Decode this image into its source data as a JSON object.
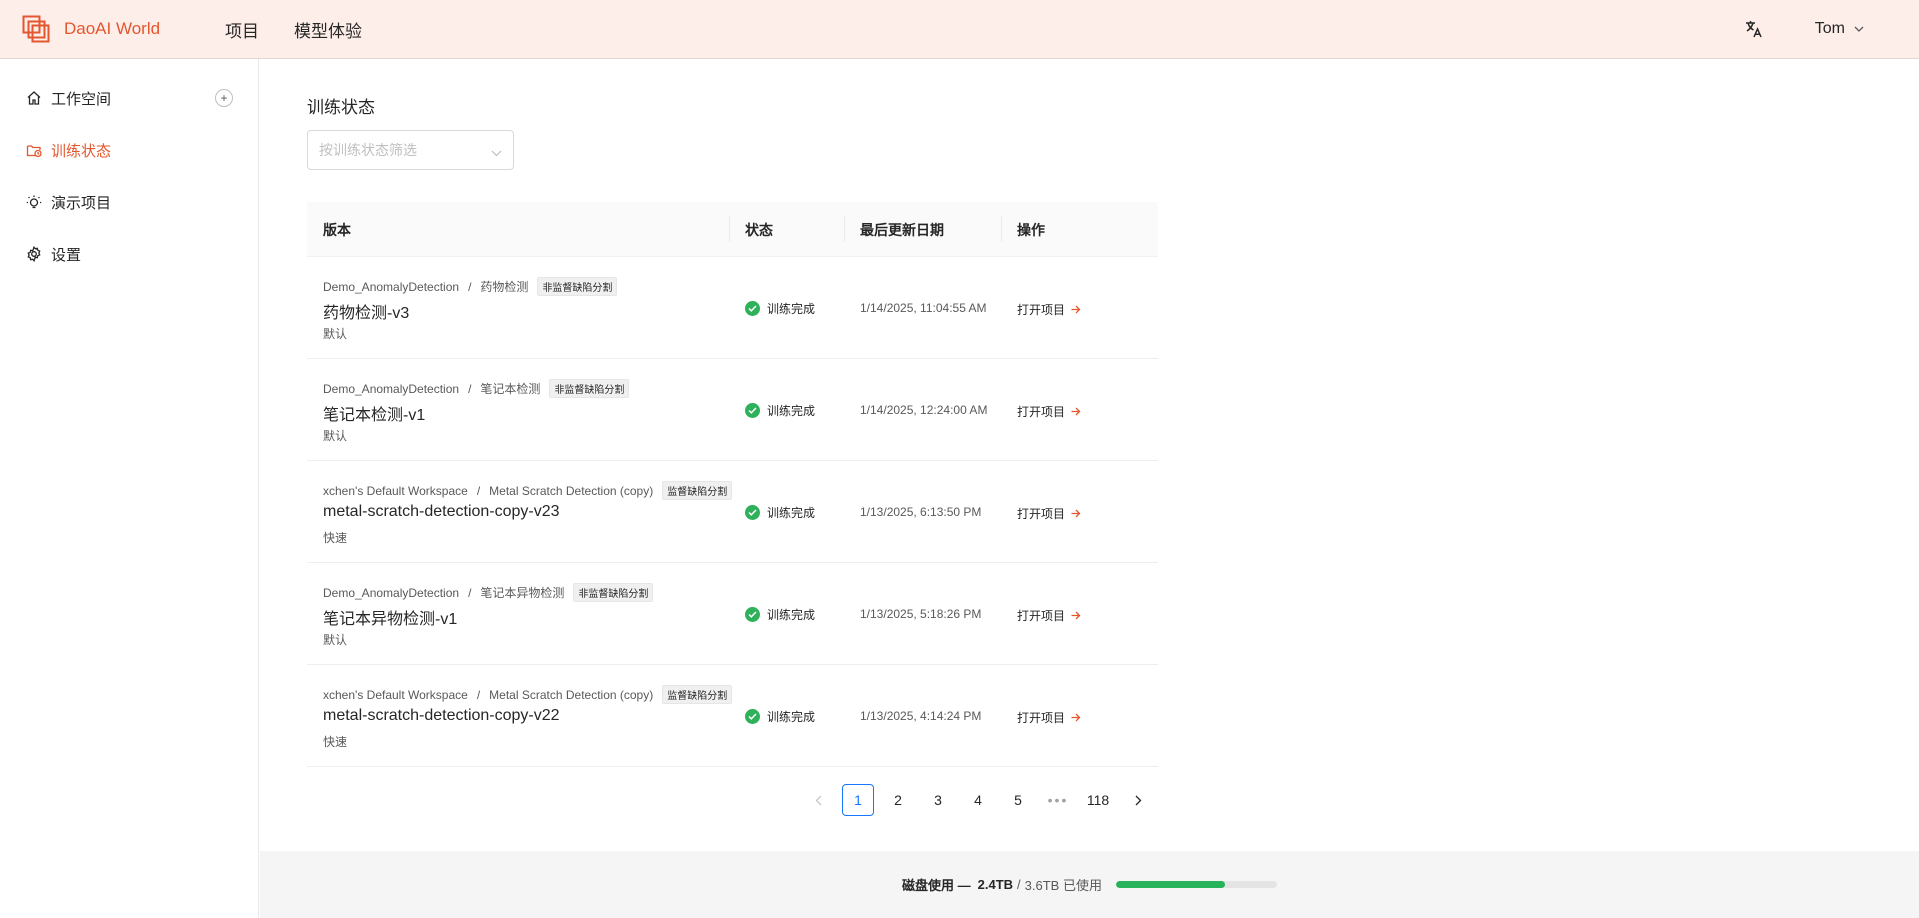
{
  "header": {
    "logo_text": "DaoAI World",
    "nav": [
      "项目",
      "模型体验"
    ],
    "user": "Tom"
  },
  "sidebar": {
    "items": [
      {
        "label": "工作空间",
        "icon": "home-icon"
      },
      {
        "label": "训练状态",
        "icon": "training-status-icon"
      },
      {
        "label": "演示项目",
        "icon": "bulb-icon"
      },
      {
        "label": "设置",
        "icon": "gear-icon"
      }
    ],
    "active_index": 1
  },
  "main": {
    "title": "训练状态",
    "filter_placeholder": "按训练状态筛选",
    "table": {
      "columns": [
        "版本",
        "状态",
        "最后更新日期",
        "操作"
      ],
      "rows": [
        {
          "workspace": "Demo_AnomalyDetection",
          "project": "药物检测",
          "tag": "非监督缺陷分割",
          "version": "药物检测-v3",
          "mode": "默认",
          "status": "训练完成",
          "date": "1/14/2025, 11:04:55 AM",
          "action": "打开项目"
        },
        {
          "workspace": "Demo_AnomalyDetection",
          "project": "笔记本检测",
          "tag": "非监督缺陷分割",
          "version": "笔记本检测-v1",
          "mode": "默认",
          "status": "训练完成",
          "date": "1/14/2025, 12:24:00 AM",
          "action": "打开项目"
        },
        {
          "workspace": "xchen's Default Workspace",
          "project": "Metal Scratch Detection (copy)",
          "tag": "监督缺陷分割",
          "version": "metal-scratch-detection-copy-v23",
          "mode": "快速",
          "status": "训练完成",
          "date": "1/13/2025, 6:13:50 PM",
          "action": "打开项目"
        },
        {
          "workspace": "Demo_AnomalyDetection",
          "project": "笔记本异物检测",
          "tag": "非监督缺陷分割",
          "version": "笔记本异物检测-v1",
          "mode": "默认",
          "status": "训练完成",
          "date": "1/13/2025, 5:18:26 PM",
          "action": "打开项目"
        },
        {
          "workspace": "xchen's Default Workspace",
          "project": "Metal Scratch Detection (copy)",
          "tag": "监督缺陷分割",
          "version": "metal-scratch-detection-copy-v22",
          "mode": "快速",
          "status": "训练完成",
          "date": "1/13/2025, 4:14:24 PM",
          "action": "打开项目"
        }
      ]
    },
    "pagination": {
      "pages": [
        "1",
        "2",
        "3",
        "4",
        "5"
      ],
      "ellipsis": "•••",
      "last": "118",
      "current": "1"
    }
  },
  "footer": {
    "label": "磁盘使用 —",
    "used": "2.4TB",
    "slash": "/",
    "total": "3.6TB 已使用",
    "progress_fraction": 0.68
  },
  "colors": {
    "brand": "#e4572e",
    "success": "#2fb05a",
    "link": "#1677ff"
  }
}
